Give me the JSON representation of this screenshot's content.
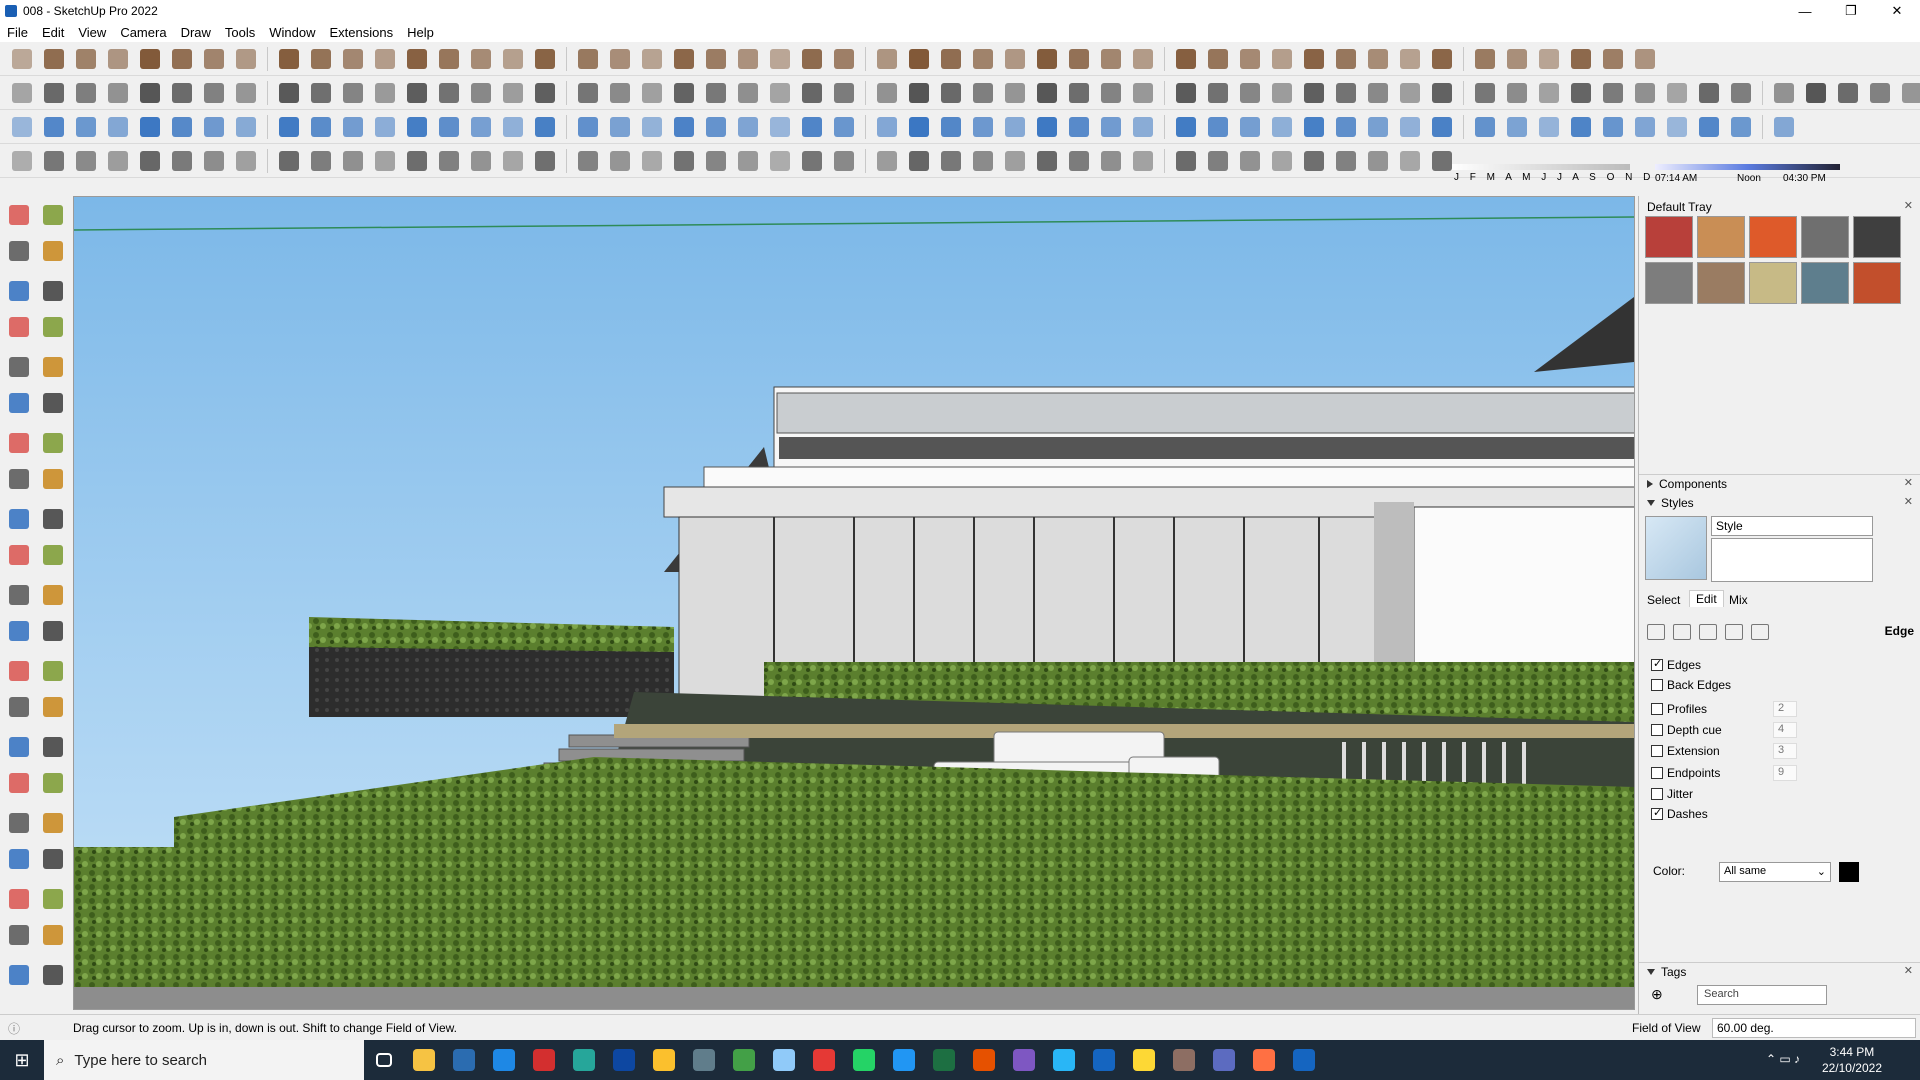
{
  "window": {
    "title": "008 - SketchUp Pro 2022",
    "minimize": "—",
    "restore": "❐",
    "close": "✕"
  },
  "menu": [
    "File",
    "Edit",
    "View",
    "Camera",
    "Draw",
    "Tools",
    "Window",
    "Extensions",
    "Help"
  ],
  "toolbar_rows": [
    {
      "count": 50,
      "tint": "#7a4f2c"
    },
    {
      "count": 58,
      "tint": "#4a4a4a"
    },
    {
      "count": 54,
      "tint": "#2f6fbf"
    },
    {
      "count": 44,
      "tint": "#5c5c5c"
    }
  ],
  "shadows": {
    "months": "J F M A M J J A S O N D",
    "time_start": "07:14 AM",
    "time_noon": "Noon",
    "time_end": "04:30 PM"
  },
  "left_tools": [
    "select-tool",
    "orbit-tool",
    "paint-bucket-tool",
    "eraser-tool",
    "make-component-tool",
    "tape-tool",
    "line-tool",
    "freehand-tool",
    "rectangle-tool",
    "rotated-rectangle-tool",
    "circle-tool",
    "polygon-tool",
    "arc-tool",
    "two-point-arc-tool",
    "three-point-arc-tool",
    "pie-tool",
    "move-tool",
    "push-pull-tool",
    "rotate-tool",
    "follow-me-tool",
    "scale-tool",
    "offset-tool",
    "tape-measure-tool",
    "dimension-tool",
    "protractor-tool",
    "text-tool",
    "axes-tool",
    "3d-text-tool",
    "orbit-view-tool",
    "pan-tool",
    "zoom-tool",
    "zoom-window-tool",
    "zoom-extents-tool",
    "previous-view-tool",
    "position-camera-tool",
    "look-around-tool",
    "walk-tool",
    "section-plane-tool",
    "display-section-tool",
    "display-cuts-tool",
    "section-fill-tool",
    "section-planes-tool"
  ],
  "tray": {
    "title": "Default Tray",
    "materials": [
      "#b8403a",
      "#c98e55",
      "#de5a2a",
      "#6f6f6f",
      "#3f3f3f",
      "#7d7d7d",
      "#9a7c62",
      "#c7ba86",
      "#5e7e8d",
      "#c24f2c"
    ],
    "components_label": "Components",
    "styles_label": "Styles",
    "style_name": "Style",
    "tabs": [
      "Select",
      "Edit",
      "Mix"
    ],
    "edge_panel_label": "Edge",
    "edge_settings": [
      {
        "label": "Edges",
        "checked": true,
        "value": ""
      },
      {
        "label": "Back Edges",
        "checked": false,
        "value": ""
      },
      {
        "label": "Profiles",
        "checked": false,
        "value": "2"
      },
      {
        "label": "Depth cue",
        "checked": false,
        "value": "4"
      },
      {
        "label": "Extension",
        "checked": false,
        "value": "3"
      },
      {
        "label": "Endpoints",
        "checked": false,
        "value": "9"
      },
      {
        "label": "Jitter",
        "checked": false,
        "value": ""
      },
      {
        "label": "Dashes",
        "checked": true,
        "value": ""
      }
    ],
    "color_label": "Color:",
    "color_value": "All same",
    "color_swatch": "#000000",
    "tags_label": "Tags",
    "tags_search_placeholder": "Search"
  },
  "status": {
    "hint": "Drag cursor to zoom.  Up is in, down is out. Shift to change Field of View.",
    "fov_label": "Field of View",
    "fov_value": "60.00 deg."
  },
  "taskbar": {
    "search_placeholder": "Type here to search",
    "apps": [
      "task-view",
      "file-explorer",
      "calculator",
      "edge",
      "acrobat",
      "photo-app",
      "photoshop",
      "chrome",
      "terminal",
      "chrome-profile",
      "notepad",
      "opera",
      "whatsapp",
      "todo",
      "excel",
      "grammarly",
      "media-player",
      "telegram",
      "defender",
      "sticky-notes",
      "winrar",
      "sketchup-viewer",
      "chrome-dev",
      "sketchup"
    ],
    "app_colors": [
      "#ffffff",
      "#f6c343",
      "#2b6cb0",
      "#1e88e5",
      "#d32f2f",
      "#26a69a",
      "#0d47a1",
      "#fbc02d",
      "#607d8b",
      "#43a047",
      "#90caf9",
      "#e53935",
      "#25d366",
      "#2196f3",
      "#1d6f42",
      "#e65100",
      "#7e57c2",
      "#29b6f6",
      "#1565c0",
      "#fdd835",
      "#8d6e63",
      "#5c6bc0",
      "#ff7043",
      "#1565c0"
    ],
    "time": "3:44 PM",
    "date": "22/10/2022"
  }
}
